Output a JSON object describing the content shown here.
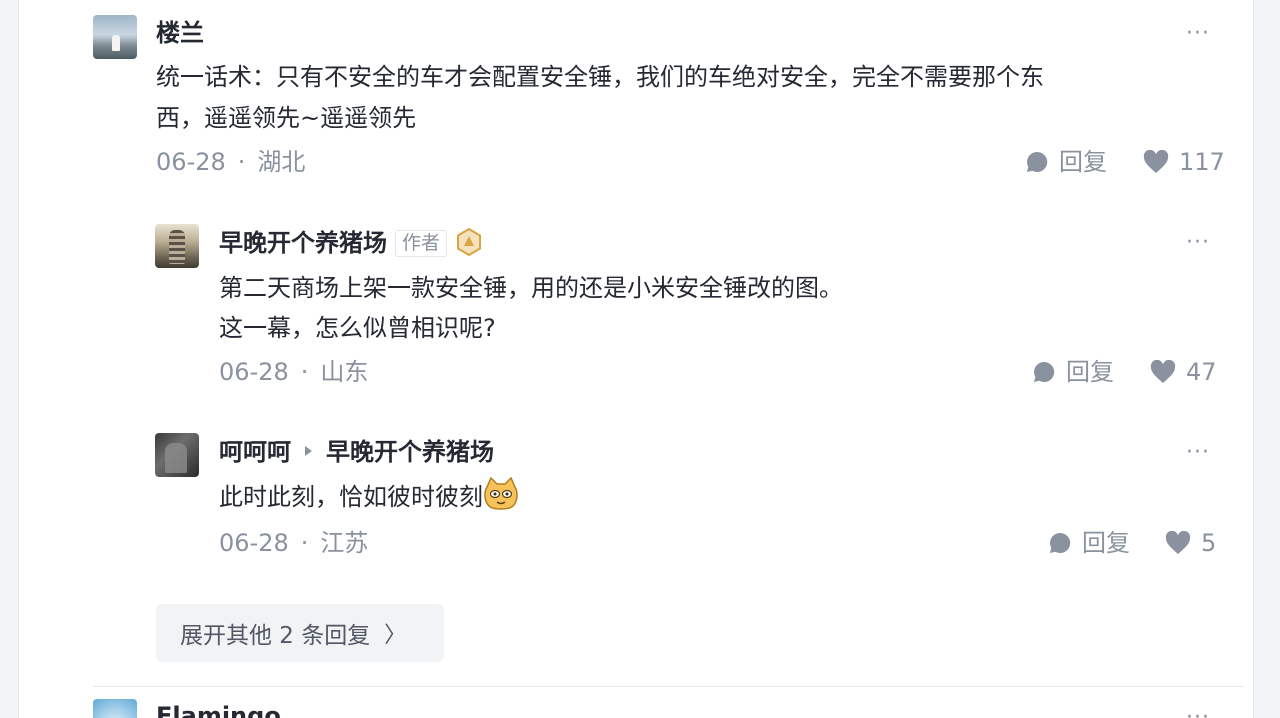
{
  "comments": [
    {
      "author": "楼兰",
      "text_lines": [
        "统一话术：只有不安全的车才会配置安全锤，我们的车绝对安全，完全不需要那个东",
        "西，遥遥领先~遥遥领先"
      ],
      "date": "06-28",
      "location": "湖北",
      "reply_label": "回复",
      "likes": "117",
      "replies": [
        {
          "author": "早晚开个养猪场",
          "author_tag": "作者",
          "text_lines": [
            "第二天商场上架一款安全锤，用的还是小米安全锤改的图。",
            "这一幕，怎么似曾相识呢?"
          ],
          "date": "06-28",
          "location": "山东",
          "reply_label": "回复",
          "likes": "47"
        },
        {
          "author": "呵呵呵",
          "reply_to": "早晚开个养猪场",
          "text": "此时此刻，恰如彼时彼刻",
          "date": "06-28",
          "location": "江苏",
          "reply_label": "回复",
          "likes": "5"
        }
      ],
      "expand_label": "展开其他 2 条回复",
      "expand_chevron": "〉"
    },
    {
      "author": "Flamingo"
    }
  ],
  "more_icon_glyph": "···",
  "meta_separator": "·",
  "colors": {
    "text": "#252933",
    "meta": "#8a919f",
    "icon": "#8a919f",
    "badge": "#d9a441",
    "surface": "#ffffff",
    "page_bg": "#f2f3f5"
  },
  "icons": [
    "comment-bubble-icon",
    "heart-icon",
    "more-icon",
    "chevron-right-icon",
    "level-badge-icon",
    "cat-emoji-icon",
    "reply-to-arrow-icon"
  ]
}
